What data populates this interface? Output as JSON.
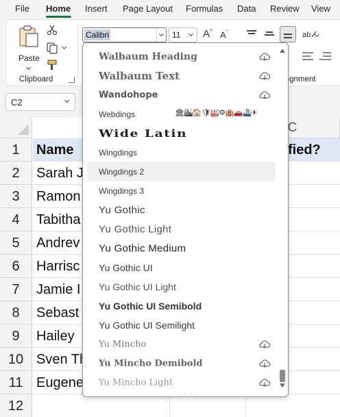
{
  "menu": {
    "tabs": [
      "File",
      "Home",
      "Insert",
      "Page Layout",
      "Formulas",
      "Data",
      "Review",
      "View"
    ],
    "active": "Home"
  },
  "ribbon": {
    "clipboard": {
      "paste_label": "Paste",
      "group_label": "Clipboard"
    },
    "font": {
      "name_value": "Calibri",
      "size_value": "11"
    },
    "alignment": {
      "group_label_partial": "lignment"
    }
  },
  "formula_bar": {
    "name_box": "C2"
  },
  "grid": {
    "columns": [
      {
        "label": "",
        "hidden_behind_dropdown": true
      },
      {
        "label": "C"
      }
    ],
    "rows": [
      "1",
      "2",
      "3",
      "4",
      "5",
      "6",
      "7",
      "8",
      "9",
      "10",
      "11",
      "12"
    ],
    "col_a_values": [
      "Name",
      "Sarah J",
      "Ramon",
      "Tabitha",
      "Andrev",
      "Harrisc",
      "Jamie I",
      "Sebast",
      "Hailey",
      "Sven Th",
      "Eugene",
      ""
    ],
    "col_c_row1": "fied?"
  },
  "font_dropdown": {
    "items": [
      {
        "name": "Walbaum Heading",
        "cloud": true
      },
      {
        "name": "Walbaum Text",
        "cloud": true
      },
      {
        "name": "Wandohope",
        "cloud": true
      },
      {
        "name": "Webdings",
        "cloud": false,
        "preview": "🏛🏙🏠🛡🏭⚙🏨🚗🚢✈"
      },
      {
        "name": "Wide Latin",
        "cloud": false
      },
      {
        "name": "Wingdings",
        "cloud": false
      },
      {
        "name": "Wingdings 2",
        "cloud": false,
        "hover": true
      },
      {
        "name": "Wingdings 3",
        "cloud": false
      },
      {
        "name": "Yu Gothic",
        "cloud": false
      },
      {
        "name": "Yu Gothic Light",
        "cloud": false
      },
      {
        "name": "Yu Gothic Medium",
        "cloud": false
      },
      {
        "name": "Yu Gothic UI",
        "cloud": false
      },
      {
        "name": "Yu Gothic UI Light",
        "cloud": false
      },
      {
        "name": "Yu Gothic UI Semibold",
        "cloud": false
      },
      {
        "name": "Yu Gothic UI Semilight",
        "cloud": false
      },
      {
        "name": "Yu Mincho",
        "cloud": true
      },
      {
        "name": "Yu Mincho Demibold",
        "cloud": true
      },
      {
        "name": "Yu Mincho Light",
        "cloud": true
      }
    ]
  }
}
